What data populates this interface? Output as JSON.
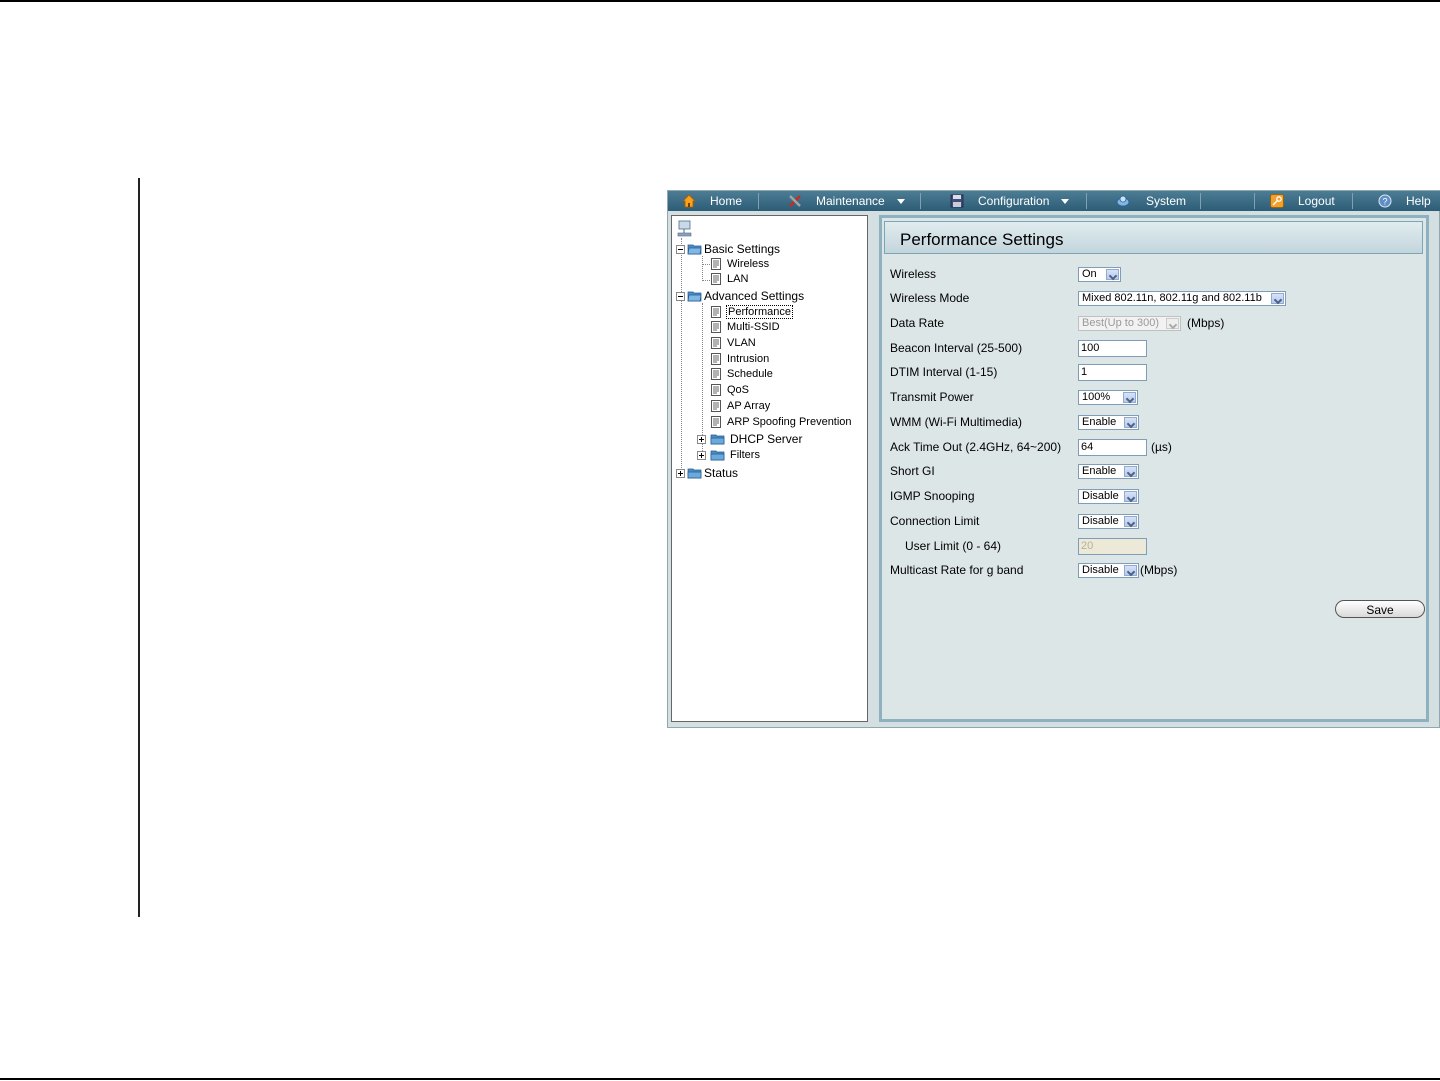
{
  "menubar": {
    "home": "Home",
    "maintenance": "Maintenance",
    "configuration": "Configuration",
    "system": "System",
    "logout": "Logout",
    "help": "Help"
  },
  "tree": {
    "basic_settings": "Basic Settings",
    "wireless": "Wireless",
    "lan": "LAN",
    "advanced_settings": "Advanced Settings",
    "performance": "Performance",
    "multi_ssid": "Multi-SSID",
    "vlan": "VLAN",
    "intrusion": "Intrusion",
    "schedule": "Schedule",
    "qos": "QoS",
    "ap_array": "AP Array",
    "arp_spoofing": "ARP Spoofing Prevention",
    "dhcp_server": "DHCP Server",
    "filters": "Filters",
    "status": "Status"
  },
  "panel": {
    "title": "Performance Settings",
    "save": "Save"
  },
  "fields": {
    "wireless": {
      "label": "Wireless",
      "value": "On"
    },
    "wireless_mode": {
      "label": "Wireless Mode",
      "value": "Mixed 802.11n, 802.11g and 802.11b"
    },
    "data_rate": {
      "label": "Data Rate",
      "value": "Best(Up to 300)",
      "unit": "(Mbps)"
    },
    "beacon_interval": {
      "label": "Beacon Interval (25-500)",
      "value": "100"
    },
    "dtim_interval": {
      "label": "DTIM Interval (1-15)",
      "value": "1"
    },
    "transmit_power": {
      "label": "Transmit Power",
      "value": "100%"
    },
    "wmm": {
      "label": "WMM (Wi-Fi Multimedia)",
      "value": "Enable"
    },
    "ack_timeout": {
      "label": "Ack Time Out  (2.4GHz, 64~200)",
      "value": "64",
      "unit": "(µs)"
    },
    "short_gi": {
      "label": "Short GI",
      "value": "Enable"
    },
    "igmp_snooping": {
      "label": "IGMP Snooping",
      "value": "Disable"
    },
    "connection_limit": {
      "label": "Connection Limit",
      "value": "Disable"
    },
    "user_limit": {
      "label": "User Limit (0 - 64)",
      "value": "20"
    },
    "multicast_rate": {
      "label": "Multicast Rate for g band",
      "value": "Disable",
      "unit": "(Mbps)"
    }
  }
}
